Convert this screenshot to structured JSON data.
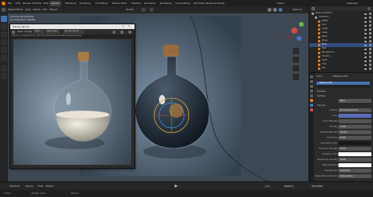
{
  "menu": [
    "File",
    "Edit",
    "Render",
    "Window",
    "Help"
  ],
  "workspace_tabs": {
    "active": "Layout",
    "items": [
      "Layout",
      "Modeling",
      "Sculpting",
      "UV Editing",
      "Texture Paint",
      "Shading",
      "Animation",
      "Rendering",
      "Compositing",
      "Geometry Nodes",
      "Scripting"
    ]
  },
  "scene_label": "Scene",
  "view_layer_label": "ViewLayer",
  "header": {
    "mode": "Object Mode",
    "view": "View",
    "select": "Select",
    "add": "Add",
    "object": "Object",
    "transform": "Global",
    "options": "Options"
  },
  "viewport": {
    "perspective_label": "Camera Perspective",
    "collection_label": "(1) Collection | Bottle"
  },
  "render_window": {
    "title": "Blender Render",
    "toolbar": {
      "view": "View",
      "image": "Image",
      "slot": "Slot 1",
      "layer": "View Layer",
      "pass": "Composite",
      "result": "Render Result"
    },
    "info": "Frame:1 | Time:00:12.81 | Mem:312.45M, Peak:362.40M | Rendering Done"
  },
  "outliner": {
    "title": "Scene Collection",
    "items": [
      {
        "label": "Scene Collection",
        "depth": 0,
        "color": "#9a9a9a",
        "selected": false
      },
      {
        "label": "Collection",
        "depth": 1,
        "color": "#9a9a9a",
        "selected": false
      },
      {
        "label": "Bottle",
        "depth": 2,
        "color": "#e07a2a",
        "selected": false
      },
      {
        "label": "Cork",
        "depth": 2,
        "color": "#e07a2a",
        "selected": false
      },
      {
        "label": "Liquid",
        "depth": 2,
        "color": "#e07a2a",
        "selected": false
      },
      {
        "label": "Glass",
        "depth": 2,
        "color": "#e07a2a",
        "selected": false
      },
      {
        "label": "Mesh",
        "depth": 2,
        "color": "#e07a2a",
        "selected": false
      },
      {
        "label": "Rings",
        "depth": 2,
        "color": "#e07a2a",
        "selected": false
      },
      {
        "label": "Floor",
        "depth": 2,
        "color": "#e07a2a",
        "selected": true
      },
      {
        "label": "Text",
        "depth": 2,
        "color": "#e07a2a",
        "selected": false
      },
      {
        "label": "Background",
        "depth": 2,
        "color": "#e07a2a",
        "selected": false
      },
      {
        "label": "Camera",
        "depth": 2,
        "color": "#e07a2a",
        "selected": false
      },
      {
        "label": "Light",
        "depth": 2,
        "color": "#e07a2a",
        "selected": false
      },
      {
        "label": "Area",
        "depth": 2,
        "color": "#e07a2a",
        "selected": false
      },
      {
        "label": "Sun",
        "depth": 2,
        "color": "#e07a2a",
        "selected": false
      }
    ]
  },
  "properties": {
    "object_label": "Floor",
    "material_label": "Material.003",
    "slot_name": "Material.003",
    "sections": {
      "preview": "Preview",
      "surface": "Surface",
      "volume": "Volume"
    },
    "surface_value": "None",
    "rows": [
      {
        "label": "Surface",
        "value": "Principled Volume"
      },
      {
        "label": "Color",
        "value": "",
        "swatch": "#5a6bb8"
      },
      {
        "label": "Color Attribute",
        "value": ""
      },
      {
        "label": "Density",
        "value": "1.000"
      },
      {
        "label": "Density Attribute",
        "value": "density"
      },
      {
        "label": "Anisotropy",
        "value": "0.000"
      },
      {
        "label": "Absorption Color",
        "value": "",
        "swatch": "#1a1a1a"
      },
      {
        "label": "Emission Strength",
        "value": "0.000"
      },
      {
        "label": "Emission Color",
        "value": "",
        "swatch": "#ffffff"
      },
      {
        "label": "Blackbody Intensity",
        "value": "0.000"
      },
      {
        "label": "Blackbody Tint",
        "value": "",
        "swatch": "#ffffff"
      },
      {
        "label": "Temperature",
        "value": "1000.000"
      },
      {
        "label": "Temperature Attribute",
        "value": "temperature"
      }
    ]
  },
  "timeline": {
    "playback": "Playback",
    "keying": "Keying",
    "view": "View",
    "marker": "Marker",
    "start": "Start 1",
    "end": "End 250",
    "frame": "1"
  },
  "status": {
    "left": "Select",
    "mid": "Rotate View",
    "right": "Object"
  }
}
